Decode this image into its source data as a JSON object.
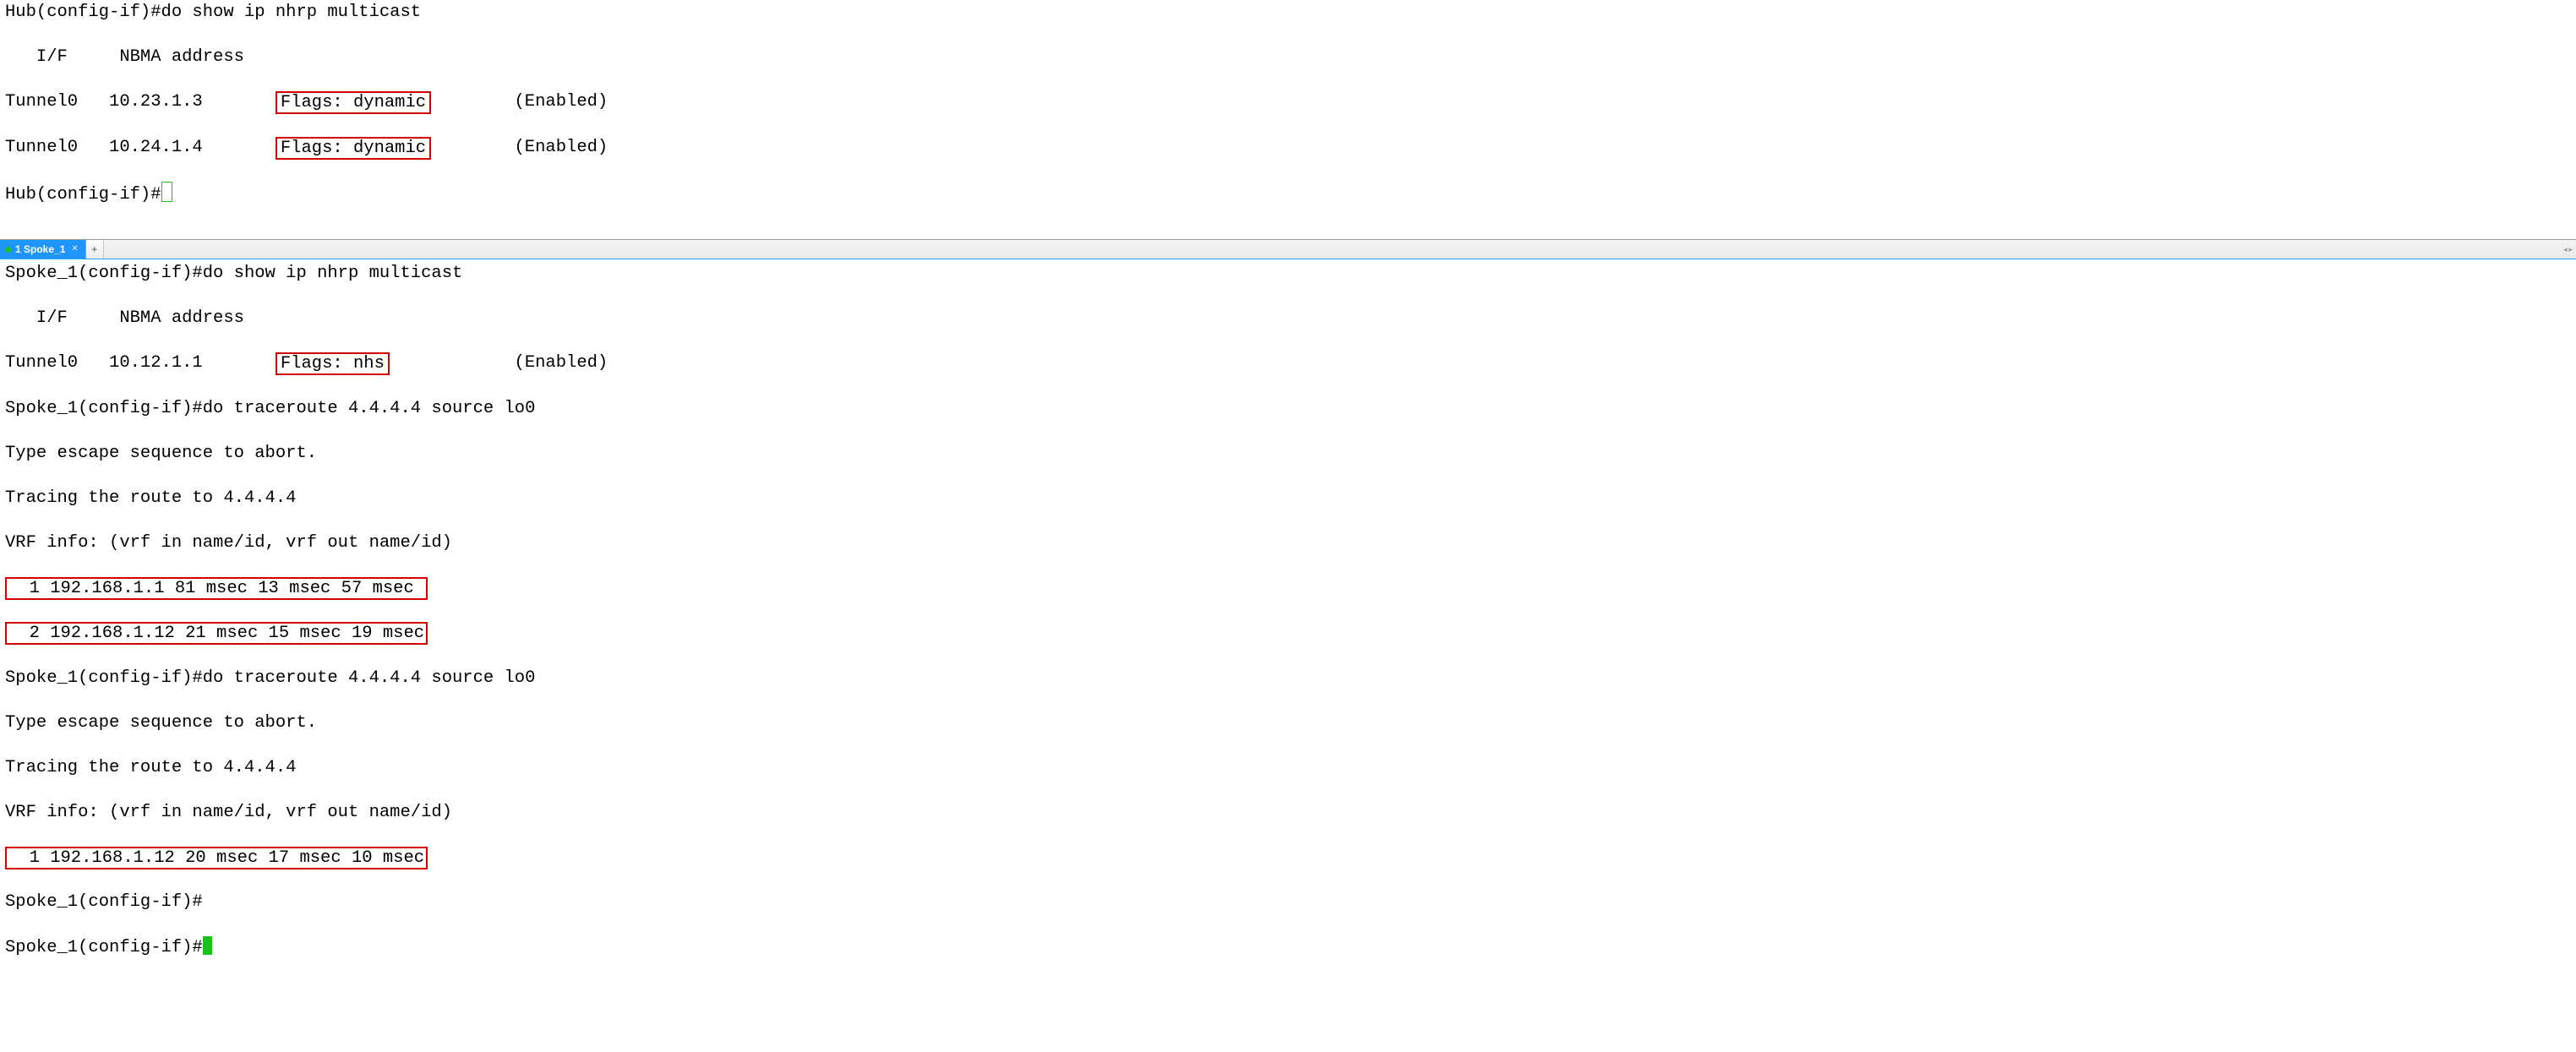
{
  "hub": {
    "prompt": "Hub(config-if)#",
    "cmd1": "do show ip nhrp multicast",
    "hdr": "   I/F     NBMA address",
    "r1_pre": "Tunnel0   10.23.1.3       ",
    "r1_box": "Flags: dynamic",
    "r1_post": "        (Enabled)",
    "r2_pre": "Tunnel0   10.24.1.4       ",
    "r2_box": "Flags: dynamic",
    "r2_post": "        (Enabled)"
  },
  "tab": {
    "title": "1 Spoke_1",
    "add": "+",
    "arrows": "◂ ▸"
  },
  "spoke": {
    "prompt": "Spoke_1(config-if)#",
    "cmd1": "do show ip nhrp multicast",
    "hdr": "   I/F     NBMA address",
    "r1_pre": "Tunnel0   10.12.1.1       ",
    "r1_box": "Flags: nhs",
    "r1_post": "            (Enabled)",
    "cmd2": "do traceroute 4.4.4.4 source lo0",
    "esc": "Type escape sequence to abort.",
    "tracing": "Tracing the route to 4.4.4.4",
    "vrf": "VRF info: (vrf in name/id, vrf out name/id)",
    "t1_hop1": "  1 192.168.1.1 81 msec 13 msec 57 msec ",
    "t1_hop2": "  2 192.168.1.12 21 msec 15 msec 19 msec",
    "t2_hop1": "  1 192.168.1.12 20 msec 17 msec 10 msec"
  }
}
